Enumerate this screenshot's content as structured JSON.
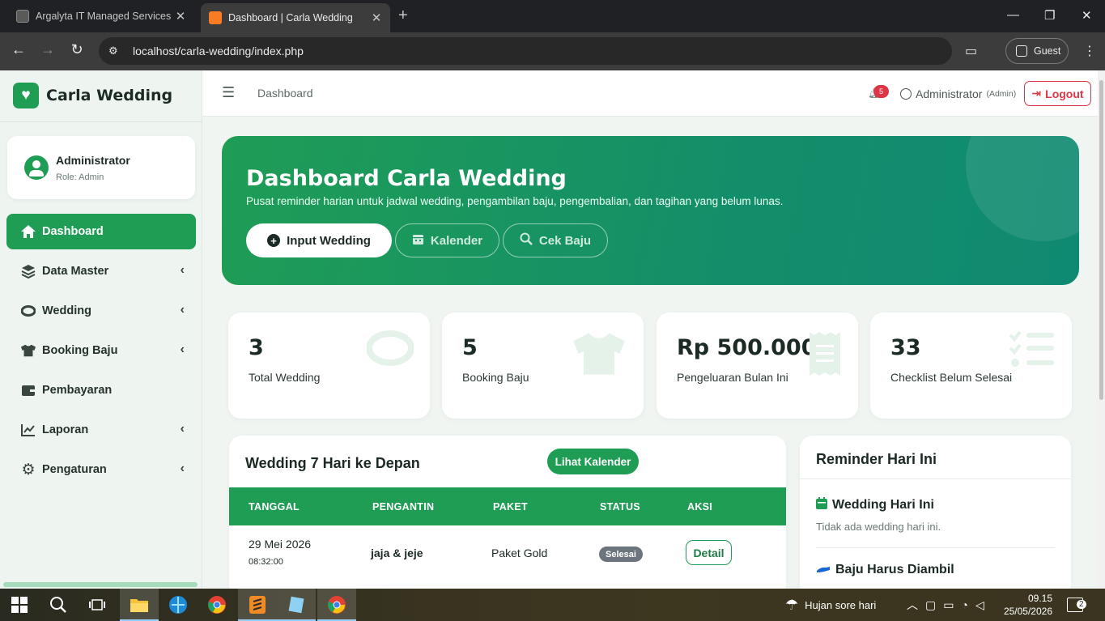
{
  "browser": {
    "tabs": [
      {
        "title": "Argalyta IT Managed Services &",
        "active": false
      },
      {
        "title": "Dashboard | Carla Wedding",
        "active": true
      }
    ],
    "url": "localhost/carla-wedding/index.php",
    "profile_label": "Guest"
  },
  "sidebar": {
    "brand": "Carla Wedding",
    "user": {
      "name": "Administrator",
      "role": "Role: Admin"
    },
    "items": [
      {
        "label": "Dashboard",
        "icon": "home-icon",
        "active": true,
        "submenu": false
      },
      {
        "label": "Data Master",
        "icon": "layers-icon",
        "active": false,
        "submenu": true
      },
      {
        "label": "Wedding",
        "icon": "ring-icon",
        "active": false,
        "submenu": true
      },
      {
        "label": "Booking Baju",
        "icon": "shirt-icon",
        "active": false,
        "submenu": true
      },
      {
        "label": "Pembayaran",
        "icon": "wallet-icon",
        "active": false,
        "submenu": false
      },
      {
        "label": "Laporan",
        "icon": "chart-line-icon",
        "active": false,
        "submenu": true
      },
      {
        "label": "Pengaturan",
        "icon": "gear-icon",
        "active": false,
        "submenu": true
      }
    ]
  },
  "topbar": {
    "breadcrumb": "Dashboard",
    "notification_count": "5",
    "user_name": "Administrator",
    "user_role": "(Admin)",
    "logout_label": "Logout"
  },
  "hero": {
    "title": "Dashboard Carla Wedding",
    "subtitle": "Pusat reminder harian untuk jadwal wedding, pengambilan baju, pengembalian, dan tagihan yang belum lunas.",
    "buttons": [
      "Input Wedding",
      "Kalender",
      "Cek Baju"
    ]
  },
  "stats": [
    {
      "value": "3",
      "label": "Total Wedding",
      "icon": "ring-icon"
    },
    {
      "value": "5",
      "label": "Booking Baju",
      "icon": "shirt-icon"
    },
    {
      "value": "Rp 500.000",
      "label": "Pengeluaran Bulan Ini",
      "icon": "receipt-icon"
    },
    {
      "value": "33",
      "label": "Checklist Belum Selesai",
      "icon": "checklist-icon"
    }
  ],
  "upcoming": {
    "title": "Wedding 7 Hari ke Depan",
    "calendar_button": "Lihat Kalender",
    "columns": [
      "TANGGAL",
      "PENGANTIN",
      "PAKET",
      "STATUS",
      "AKSI"
    ],
    "rows": [
      {
        "date": "29 Mei 2026",
        "time": "08:32:00",
        "couple": "jaja & jeje",
        "package": "Paket Gold",
        "status": "Selesai",
        "action": "Detail"
      }
    ]
  },
  "reminder": {
    "title": "Reminder Hari Ini",
    "sections": [
      {
        "title": "Wedding Hari Ini",
        "desc": "Tidak ada wedding hari ini.",
        "icon": "calendar-icon"
      },
      {
        "title": "Baju Harus Diambil",
        "desc": "",
        "icon": "hand-icon"
      }
    ]
  },
  "taskbar": {
    "weather": "Hujan sore hari",
    "time": "09.15",
    "date": "25/05/2026",
    "notifications": "2"
  },
  "colors": {
    "primary": "#1f9d55",
    "danger": "#dc3545",
    "badge_gray": "#6c757d"
  }
}
